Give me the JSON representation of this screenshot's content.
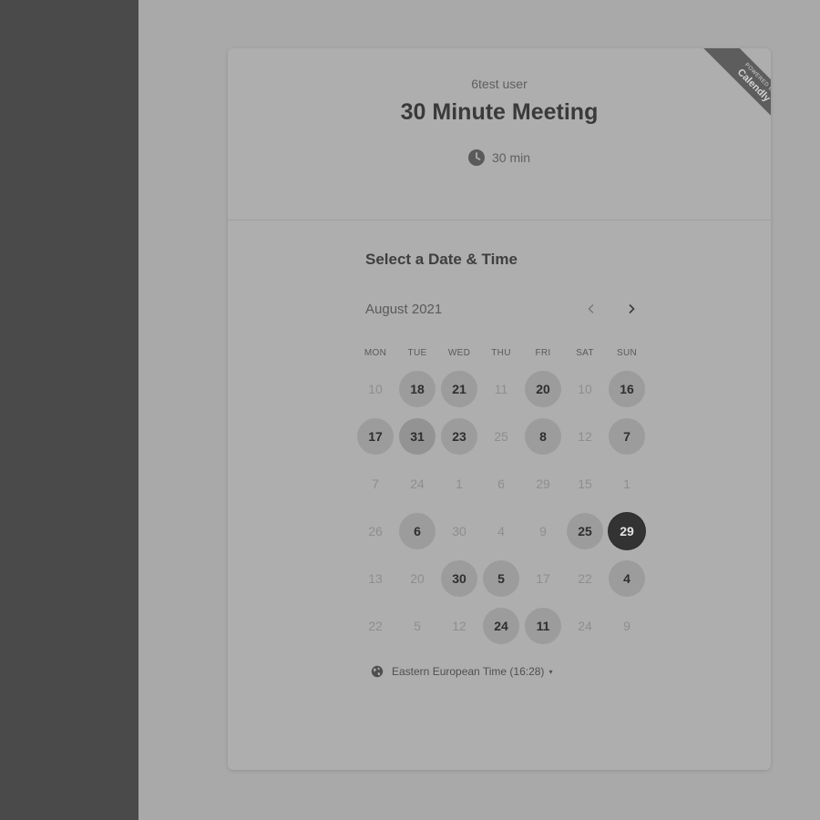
{
  "branding": {
    "powered_by": "POWERED BY",
    "brand": "Calendly"
  },
  "event": {
    "organizer": "6test user",
    "title": "30 Minute Meeting",
    "duration": "30 min"
  },
  "calendar": {
    "section_title": "Select a Date & Time",
    "month": "August 2021",
    "weekdays": [
      "MON",
      "TUE",
      "WED",
      "THU",
      "FRI",
      "SAT",
      "SUN"
    ],
    "days": [
      {
        "label": "10",
        "available": false
      },
      {
        "label": "18",
        "available": true
      },
      {
        "label": "21",
        "available": true
      },
      {
        "label": "11",
        "available": false
      },
      {
        "label": "20",
        "available": true
      },
      {
        "label": "10",
        "available": false
      },
      {
        "label": "16",
        "available": true
      },
      {
        "label": "17",
        "available": true
      },
      {
        "label": "31",
        "available": true,
        "highlight": true
      },
      {
        "label": "23",
        "available": true
      },
      {
        "label": "25",
        "available": false
      },
      {
        "label": "8",
        "available": true
      },
      {
        "label": "12",
        "available": false
      },
      {
        "label": "7",
        "available": true
      },
      {
        "label": "7",
        "available": false
      },
      {
        "label": "24",
        "available": false
      },
      {
        "label": "1",
        "available": false
      },
      {
        "label": "6",
        "available": false
      },
      {
        "label": "29",
        "available": false
      },
      {
        "label": "15",
        "available": false
      },
      {
        "label": "1",
        "available": false
      },
      {
        "label": "26",
        "available": false
      },
      {
        "label": "6",
        "available": true
      },
      {
        "label": "30",
        "available": false
      },
      {
        "label": "4",
        "available": false
      },
      {
        "label": "9",
        "available": false
      },
      {
        "label": "25",
        "available": true
      },
      {
        "label": "29",
        "available": true,
        "selected": true
      },
      {
        "label": "13",
        "available": false
      },
      {
        "label": "20",
        "available": false
      },
      {
        "label": "30",
        "available": true
      },
      {
        "label": "5",
        "available": true
      },
      {
        "label": "17",
        "available": false
      },
      {
        "label": "22",
        "available": false
      },
      {
        "label": "4",
        "available": true
      },
      {
        "label": "22",
        "available": false
      },
      {
        "label": "5",
        "available": false
      },
      {
        "label": "12",
        "available": false
      },
      {
        "label": "24",
        "available": true
      },
      {
        "label": "11",
        "available": true
      },
      {
        "label": "24",
        "available": false
      },
      {
        "label": "9",
        "available": false
      }
    ]
  },
  "timezone": {
    "label": "Eastern European Time (16:28)",
    "caret": "▾"
  },
  "icons": {
    "clock": "clock-icon",
    "globe": "globe-icon",
    "prev": "chevron-left-icon",
    "next": "chevron-right-icon"
  }
}
